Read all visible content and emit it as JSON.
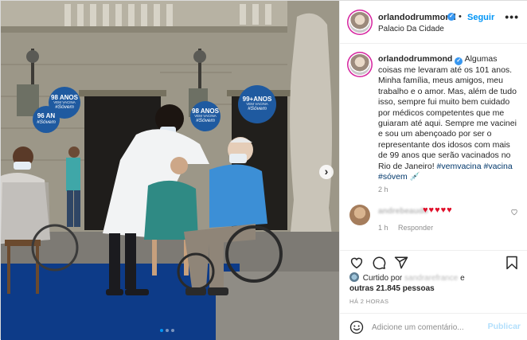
{
  "photo": {
    "signs": [
      {
        "big": "98 ANOS",
        "small": "VEM VACINA",
        "tag": "#Sóvem"
      },
      {
        "big": "96 AN",
        "small": "",
        "tag": "#Sóvem"
      },
      {
        "big": "98 ANOS",
        "small": "VEM VACINA",
        "tag": "#Sóvem"
      },
      {
        "big": "99+ANOS",
        "small": "VEM VACINA",
        "tag": "#Sóvem"
      }
    ],
    "next_icon": "chevron-right-icon",
    "slides_total": 3,
    "slide_active": 1
  },
  "header": {
    "username": "orlandodrummond",
    "separator": "•",
    "follow_label": "Seguir",
    "location": "Palacio Da Cidade",
    "more_icon": "•••"
  },
  "caption": {
    "username": "orlandodrummond",
    "text": "Algumas coisas me levaram até os 101 anos. Minha família, meus amigos, meu trabalho e o amor. Mas, além de tudo isso, sempre fui muito bem cuidado por médicos competentes que me guiaram até aqui. Sempre me vacinei e sou um abençoado por ser o representante dos idosos com mais de 99 anos que serão vacinados no Rio de Janeiro!",
    "hashtags": "#vemvacina #vacina #sóvem",
    "emoji": "💉",
    "time": "2 h"
  },
  "comment": {
    "username": "andrebeaudo",
    "hearts": "♥♥♥♥♥",
    "time": "1 h",
    "reply_label": "Responder"
  },
  "likes": {
    "prefix": "Curtido por",
    "user": "sandrarefrance",
    "middle": "e",
    "others": "outras 21.845 pessoas"
  },
  "post_time": "HÁ 2 HORAS",
  "add_comment": {
    "placeholder": "Adicione um comentário...",
    "publish_label": "Publicar"
  },
  "colors": {
    "accent": "#0095f6",
    "sign_blue": "#1f5aa0",
    "heart_red": "#e0102a"
  }
}
